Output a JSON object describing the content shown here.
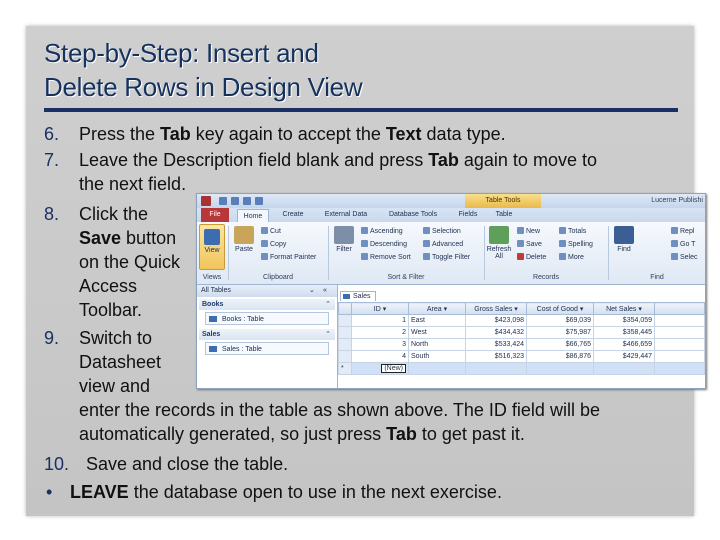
{
  "title": {
    "line1": "Step-by-Step: Insert and",
    "line2": "Delete Rows in Design View"
  },
  "steps": {
    "s6": {
      "num": "6.",
      "pre": "Press the ",
      "b1": "Tab",
      "mid": " key again to accept the ",
      "b2": "Text",
      "post": " data type."
    },
    "s7": {
      "num": "7.",
      "pre": "Leave the Description field blank and press ",
      "b1": "Tab",
      "post": " again to move to",
      "line2": "the next field."
    },
    "s8": {
      "num": "8.",
      "l1": "Click the",
      "b1": "Save",
      "l2post": " button",
      "l3": "on the Quick",
      "l4": "Access",
      "l5": "Toolbar."
    },
    "s9": {
      "num": "9.",
      "l1": "Switch to",
      "l2": "Datasheet",
      "l3": "view and",
      "l4": "enter the records in the table as shown above. The ID field will be",
      "l5pre": "automatically generated, so just press ",
      "l5b": "Tab",
      "l5post": " to get past it."
    },
    "s10": {
      "num": "10.",
      "text": "Save and close the table."
    },
    "bullet": {
      "sym": "•",
      "b": "LEAVE",
      "text": " the database open to use in the next exercise."
    }
  },
  "screenshot": {
    "table_tools": "Table Tools",
    "window_title": "Lucerne Publishi",
    "tabs": [
      "File",
      "Home",
      "Create",
      "External Data",
      "Database Tools",
      "Fields",
      "Table"
    ],
    "views_label": "Views",
    "view_btn": "View",
    "clipboard": {
      "label": "Clipboard",
      "paste": "Paste",
      "cut": "Cut",
      "copy": "Copy",
      "format_painter": "Format Painter"
    },
    "sort_filter": {
      "label": "Sort & Filter",
      "filter": "Filter",
      "ascending": "Ascending",
      "descending": "Descending",
      "remove_sort": "Remove Sort",
      "selection": "Selection",
      "advanced": "Advanced",
      "toggle_filter": "Toggle Filter"
    },
    "records": {
      "label": "Records",
      "refresh": "Refresh All",
      "new": "New",
      "save": "Save",
      "delete": "Delete",
      "totals": "Totals",
      "spelling": "Spelling",
      "more": "More"
    },
    "find": {
      "label": "Find",
      "find": "Find",
      "replace": "Repl",
      "goto": "Go T",
      "select": "Selec"
    },
    "nav": {
      "header": "All Tables",
      "collapse": "«",
      "groups": [
        {
          "name": "Books",
          "item": "Books : Table"
        },
        {
          "name": "Sales",
          "item": "Sales : Table"
        }
      ]
    },
    "doc_tab": "Sales",
    "columns": [
      "ID",
      "Area",
      "Gross Sales",
      "Cost of Good",
      "Net Sales"
    ],
    "rows": [
      [
        "1",
        "East",
        "$423,098",
        "$69,039",
        "$354,059"
      ],
      [
        "2",
        "West",
        "$434,432",
        "$75,987",
        "$358,445"
      ],
      [
        "3",
        "North",
        "$533,424",
        "$66,765",
        "$466,659"
      ],
      [
        "4",
        "South",
        "$516,323",
        "$86,876",
        "$429,447"
      ]
    ],
    "new_row": {
      "marker": "*",
      "id": "(New)"
    }
  }
}
